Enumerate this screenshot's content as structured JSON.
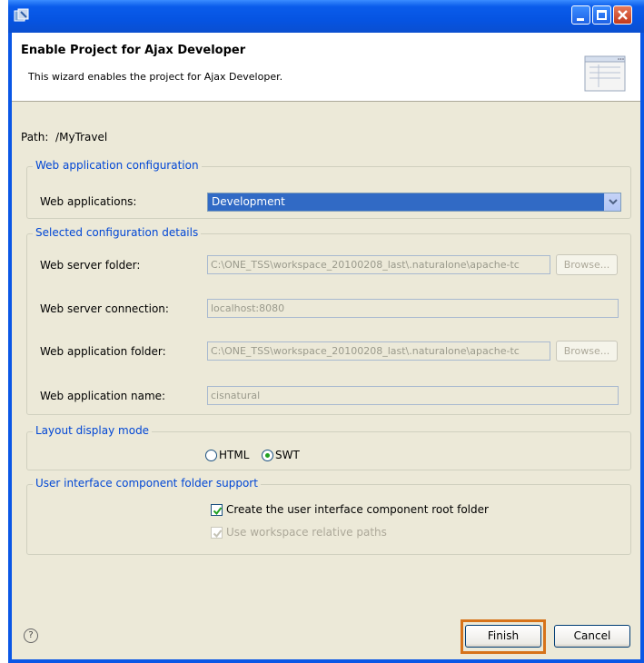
{
  "header": {
    "title": "Enable Project for Ajax Developer",
    "description": "This wizard enables the project for Ajax Developer."
  },
  "path": {
    "label": "Path:",
    "value": "/MyTravel"
  },
  "web_app_config": {
    "title": "Web application configuration",
    "web_applications_label": "Web applications:",
    "web_applications_value": "Development"
  },
  "config_details": {
    "title": "Selected configuration details",
    "server_folder_label": "Web server folder:",
    "server_folder_value": "C:\\ONE_TSS\\workspace_20100208_last\\.naturalone\\apache-tc",
    "server_connection_label": "Web server connection:",
    "server_connection_value": "localhost:8080",
    "app_folder_label": "Web application folder:",
    "app_folder_value": "C:\\ONE_TSS\\workspace_20100208_last\\.naturalone\\apache-tc",
    "app_name_label": "Web application name:",
    "app_name_value": "cisnatural",
    "browse_label": "Browse..."
  },
  "layout_mode": {
    "title": "Layout display mode",
    "options": [
      "HTML",
      "SWT"
    ],
    "selected": "SWT"
  },
  "ui_folder": {
    "title": "User interface component folder support",
    "create_root_label": "Create the user interface component root folder",
    "create_root_checked": true,
    "relative_paths_label": "Use workspace relative paths",
    "relative_paths_checked": true
  },
  "footer": {
    "help_icon": "question-circle-icon",
    "finish_label": "Finish",
    "cancel_label": "Cancel"
  },
  "colors": {
    "titlebar": "#0A5CEB",
    "group_title": "#0046D5",
    "selection": "#316AC5",
    "highlight": "#D7731A"
  }
}
